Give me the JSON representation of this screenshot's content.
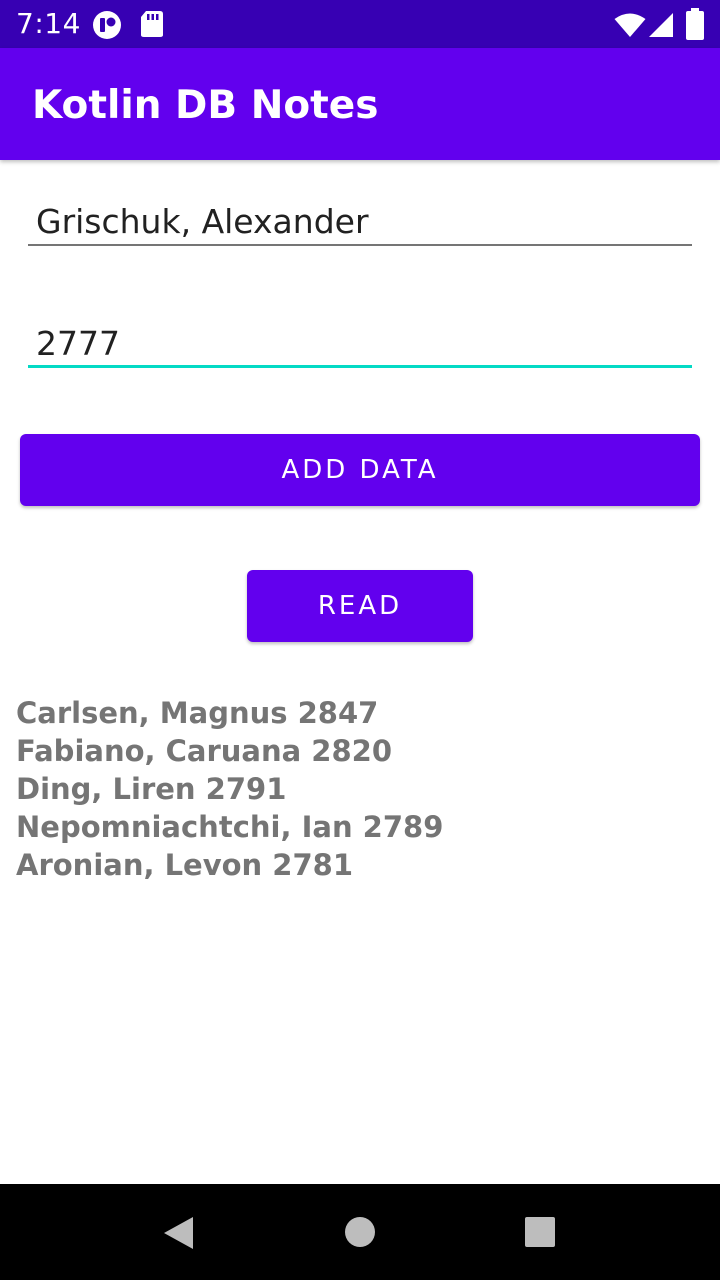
{
  "status_bar": {
    "time": "7:14",
    "icons": [
      "notification-app-icon",
      "sd-card-icon",
      "wifi-icon",
      "cellular-signal-icon",
      "battery-icon"
    ]
  },
  "app_bar": {
    "title": "Kotlin DB Notes"
  },
  "form": {
    "name_value": "Grischuk, Alexander",
    "score_value": "2777"
  },
  "buttons": {
    "add_label": "ADD DATA",
    "read_label": "READ"
  },
  "results": [
    "Carlsen, Magnus 2847",
    "Fabiano, Caruana 2820",
    "Ding, Liren 2791",
    "Nepomniachtchi, Ian 2789",
    "Aronian, Levon 2781"
  ],
  "nav_bar": {
    "icons": [
      "back-icon",
      "home-icon",
      "recents-icon"
    ]
  },
  "colors": {
    "primary": "#6200EE",
    "primary_dark": "#3700B3",
    "accent": "#03DAC5",
    "result_text": "#757575"
  }
}
